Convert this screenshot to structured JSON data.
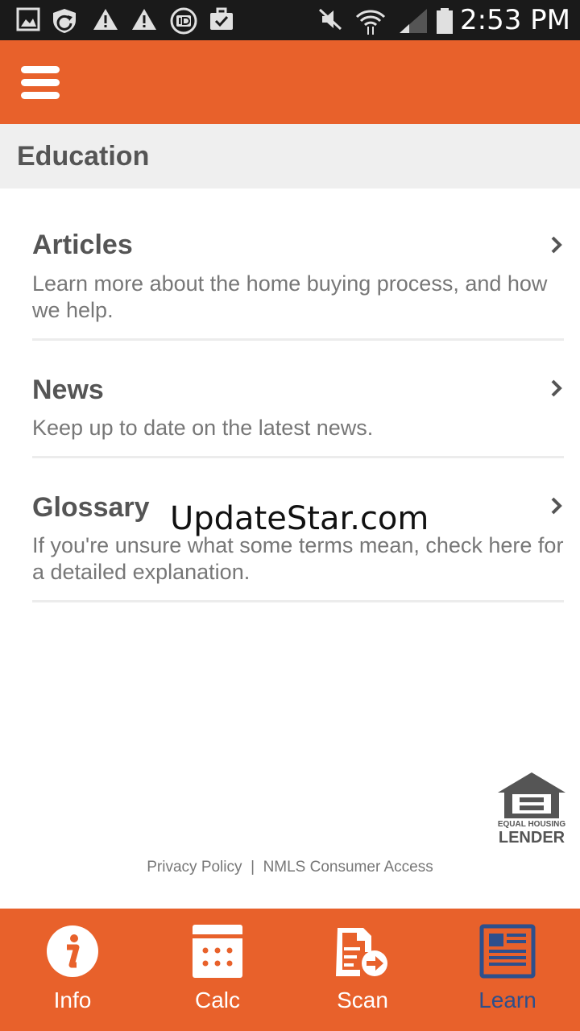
{
  "status_bar": {
    "time": "2:53 PM"
  },
  "app_bar": {
    "menu_icon": "hamburger-menu-icon"
  },
  "section": {
    "title": "Education"
  },
  "items": [
    {
      "title": "Articles",
      "description": "Learn more about the home buying process, and how we help."
    },
    {
      "title": "News",
      "description": "Keep up to date on the latest news."
    },
    {
      "title": "Glossary",
      "description": "If you're unsure what some terms mean, check here for a detailed explanation."
    }
  ],
  "watermark": "UpdateStar.com",
  "logo": {
    "line1": "EQUAL HOUSING",
    "line2": "LENDER"
  },
  "footer": {
    "privacy": "Privacy Policy",
    "separator": "|",
    "nmls": "NMLS Consumer Access"
  },
  "bottom_nav": [
    {
      "label": "Info",
      "icon": "info-icon",
      "active": false
    },
    {
      "label": "Calc",
      "icon": "calculator-icon",
      "active": false
    },
    {
      "label": "Scan",
      "icon": "scan-document-icon",
      "active": false
    },
    {
      "label": "Learn",
      "icon": "newspaper-icon",
      "active": true
    }
  ],
  "colors": {
    "brand": "#e8612b",
    "active_tab": "#2d4f8c",
    "header_bg": "#efefef",
    "title_text": "#555555",
    "body_text": "#777777"
  }
}
